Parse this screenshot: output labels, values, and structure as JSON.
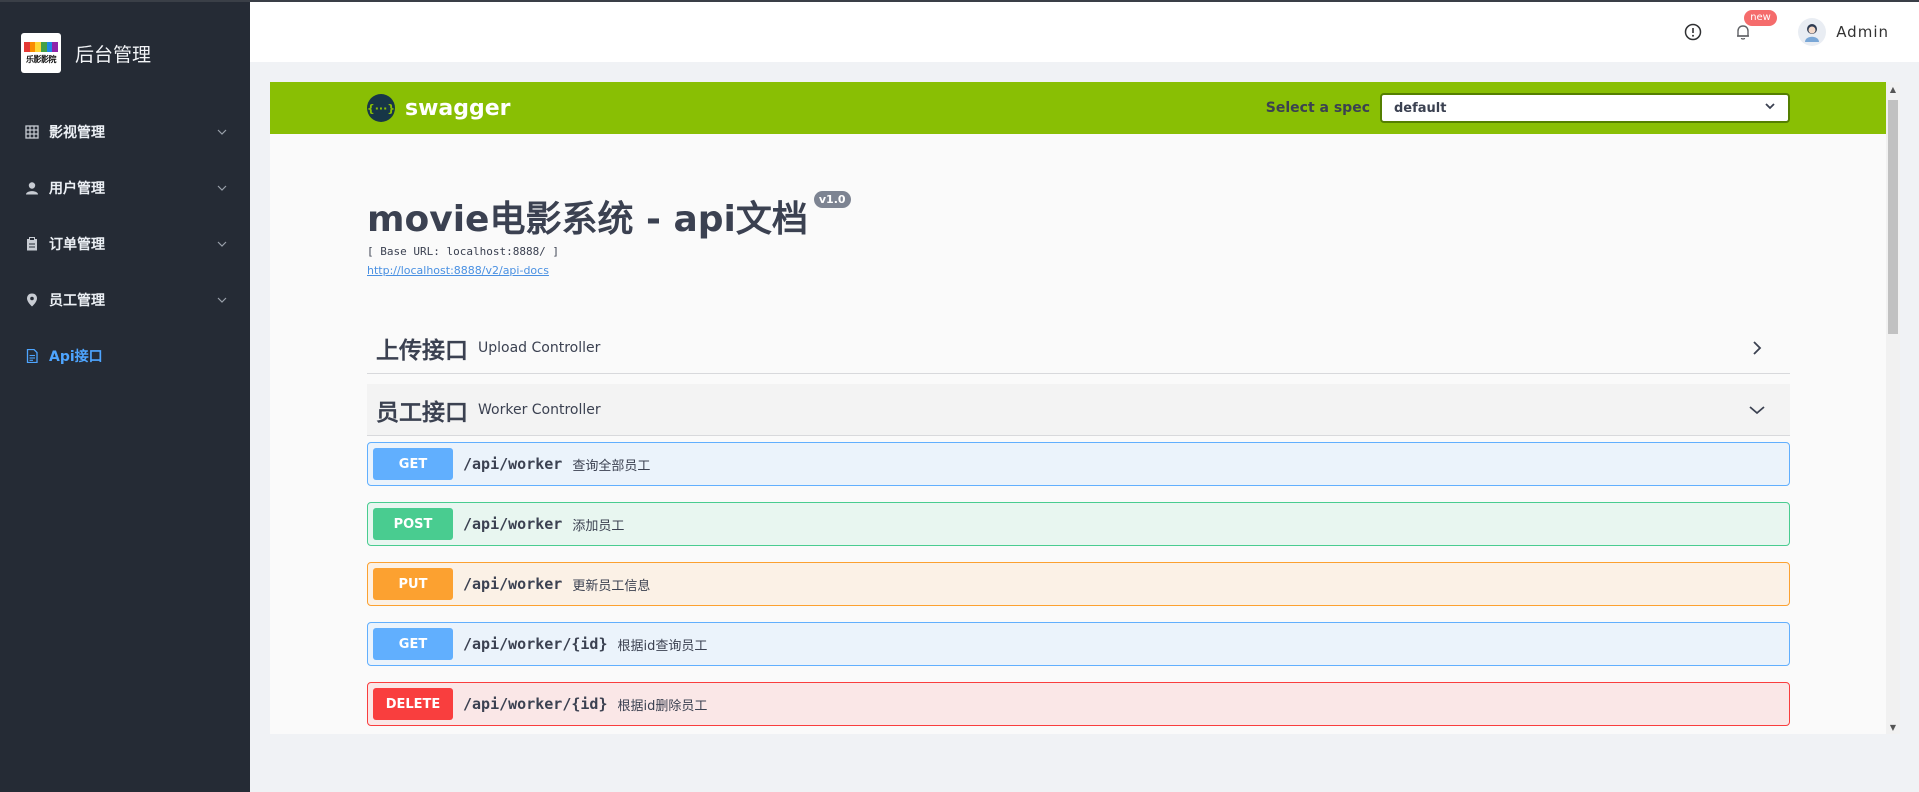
{
  "app": {
    "title": "后台管理",
    "logo_text": "乐影影院"
  },
  "sidebar": {
    "items": [
      {
        "label": "影视管理",
        "icon": "grid-icon",
        "expandable": true
      },
      {
        "label": "用户管理",
        "icon": "user-icon",
        "expandable": true
      },
      {
        "label": "订单管理",
        "icon": "clipboard-icon",
        "expandable": true
      },
      {
        "label": "员工管理",
        "icon": "location-icon",
        "expandable": true
      },
      {
        "label": "Api接口",
        "icon": "document-icon",
        "expandable": false,
        "active": true
      }
    ]
  },
  "header": {
    "badge": "new",
    "username": "Admin"
  },
  "swagger": {
    "brand": "swagger",
    "spec_label": "Select a spec",
    "spec_value": "default",
    "title": "movie电影系统 - api文档",
    "version": "v1.0",
    "base_url": "[ Base URL: localhost:8888/ ]",
    "docs_link": "http://localhost:8888/v2/api-docs",
    "tags": [
      {
        "name": "上传接口",
        "desc": "Upload Controller",
        "open": false
      },
      {
        "name": "员工接口",
        "desc": "Worker Controller",
        "open": true
      }
    ],
    "operations": [
      {
        "method": "GET",
        "path": "/api/worker",
        "summary": "查询全部员工"
      },
      {
        "method": "POST",
        "path": "/api/worker",
        "summary": "添加员工"
      },
      {
        "method": "PUT",
        "path": "/api/worker",
        "summary": "更新员工信息"
      },
      {
        "method": "GET",
        "path": "/api/worker/{id}",
        "summary": "根据id查询员工"
      },
      {
        "method": "DELETE",
        "path": "/api/worker/{id}",
        "summary": "根据id删除员工"
      }
    ]
  },
  "colors": {
    "sidebar_bg": "#252b35",
    "active": "#4ea5ff",
    "swagger_green": "#89bf04",
    "get": "#61affe",
    "post": "#49cc90",
    "put": "#fca130",
    "delete": "#f93e3e"
  }
}
